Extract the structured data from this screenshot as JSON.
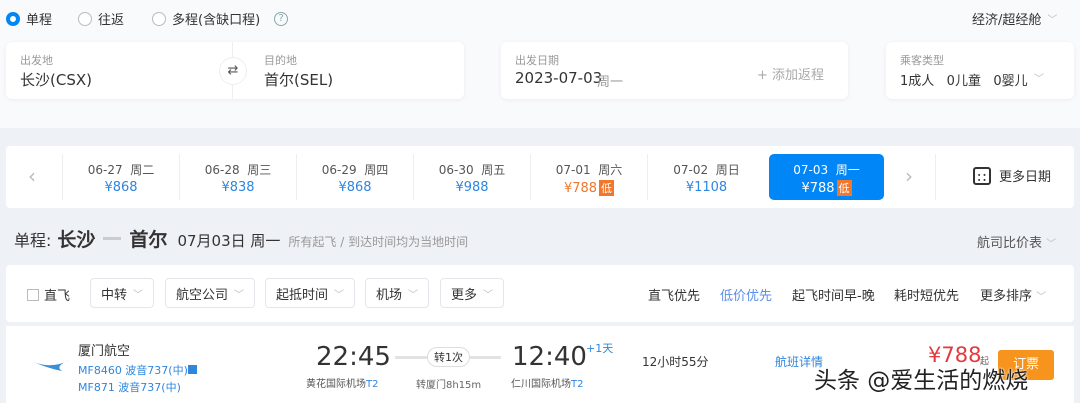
{
  "trip_types": [
    {
      "label": "单程",
      "selected": true
    },
    {
      "label": "往返",
      "selected": false
    },
    {
      "label": "多程(含缺口程)",
      "selected": false
    }
  ],
  "cabin": "经济/超经舱",
  "search": {
    "from_label": "出发地",
    "from": "长沙(CSX)",
    "to_label": "目的地",
    "to": "首尔(SEL)",
    "date_label": "出发日期",
    "date": "2023-07-03",
    "weekday": "周一",
    "add_return": "+ 添加返程",
    "pax_label": "乘客类型",
    "pax": "1成人   0儿童   0婴儿"
  },
  "dates": [
    {
      "date": "06-27  周二",
      "price": "¥868"
    },
    {
      "date": "06-28  周三",
      "price": "¥838"
    },
    {
      "date": "06-29  周四",
      "price": "¥868"
    },
    {
      "date": "06-30  周五",
      "price": "¥988"
    },
    {
      "date": "07-01  周六",
      "price": "¥788",
      "tag": "低"
    },
    {
      "date": "07-02  周日",
      "price": "¥1108"
    },
    {
      "date": "07-03  周一",
      "price": "¥788",
      "tag": "低",
      "selected": true
    }
  ],
  "more_dates": "更多日期",
  "heading": {
    "prefix": "单程:",
    "from": "长沙",
    "to": "首尔",
    "date": "07月03日 周一",
    "note": "所有起飞 / 到达时间均为当地时间",
    "compare": "航司比价表"
  },
  "filters": {
    "direct": "直飞",
    "buttons": [
      "中转",
      "航空公司",
      "起抵时间",
      "机场",
      "更多"
    ],
    "sorts": [
      "直飞优先",
      "低价优先",
      "起飞时间早-晚",
      "耗时短优先",
      "更多排序"
    ]
  },
  "flight": {
    "airline": "厦门航空",
    "seg1": "MF8460 波音737(中)",
    "seg2": "MF871 波音737(中)",
    "dep_time": "22:45",
    "dep_airport": "黄花国际机场",
    "dep_term": "T2",
    "transfer": "转1次",
    "transfer_info": "转厦门8h15m",
    "arr_time": "12:40",
    "plus_day": "+1天",
    "arr_airport": "仁川国际机场",
    "arr_term": "T2",
    "duration": "12小时55分",
    "detail": "航班详情",
    "price": "¥788",
    "price_suffix": "起",
    "book": "订票"
  },
  "watermark": "头条 @爱生活的燃烧",
  "colors": {
    "accent": "#0086f6",
    "low": "#f0772b",
    "price": "#e4393c"
  }
}
